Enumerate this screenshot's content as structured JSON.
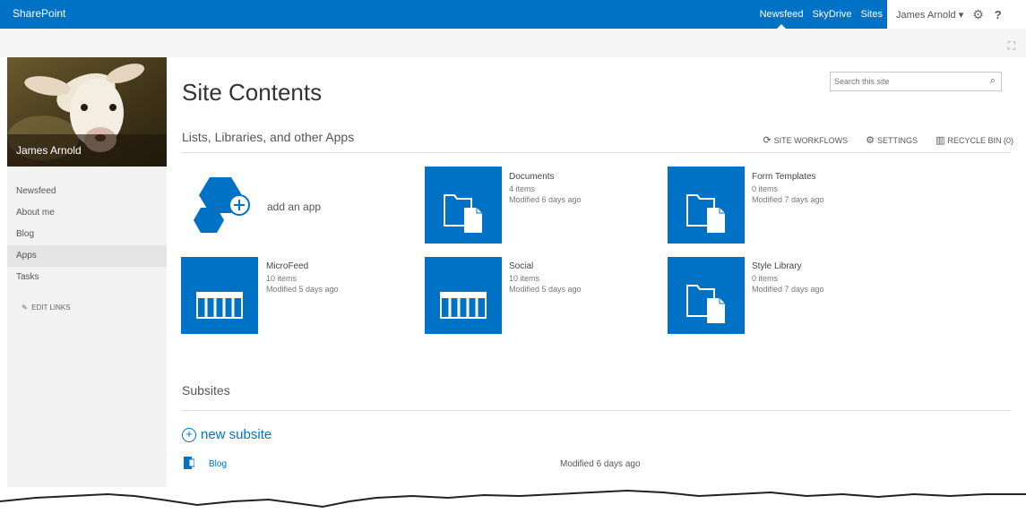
{
  "suite_bar": {
    "brand": "SharePoint",
    "links": [
      "Newsfeed",
      "SkyDrive",
      "Sites"
    ],
    "user_name": "James Arnold",
    "help": "?"
  },
  "profile": {
    "name": "James Arnold"
  },
  "left_nav": {
    "items": [
      "Newsfeed",
      "About me",
      "Blog",
      "Apps",
      "Tasks"
    ],
    "selected": "Apps",
    "edit_links": "EDIT LINKS"
  },
  "page": {
    "title": "Site Contents",
    "search_placeholder": "Search this site"
  },
  "apps_section": {
    "title": "Lists, Libraries, and other Apps",
    "actions": [
      "SITE WORKFLOWS",
      "SETTINGS",
      "RECYCLE BIN (0)"
    ],
    "add_app_label": "add an app",
    "tiles": [
      {
        "name": "Documents",
        "count": "4 items",
        "modified": "Modified 6 days ago",
        "icon": "library-icon"
      },
      {
        "name": "Form Templates",
        "count": "0 items",
        "modified": "Modified 7 days ago",
        "icon": "library-icon"
      },
      {
        "name": "MicroFeed",
        "count": "10 items",
        "modified": "Modified 5 days ago",
        "icon": "list-icon"
      },
      {
        "name": "Social",
        "count": "10 items",
        "modified": "Modified 5 days ago",
        "icon": "list-icon"
      },
      {
        "name": "Style Library",
        "count": "0 items",
        "modified": "Modified 7 days ago",
        "icon": "library-icon"
      }
    ]
  },
  "subsites": {
    "title": "Subsites",
    "new_label": "new subsite",
    "items": [
      {
        "name": "Blog",
        "modified": "Modified 6 days ago"
      }
    ]
  },
  "colors": {
    "accent": "#0072c6",
    "nav_bg": "#f2f2f2"
  }
}
